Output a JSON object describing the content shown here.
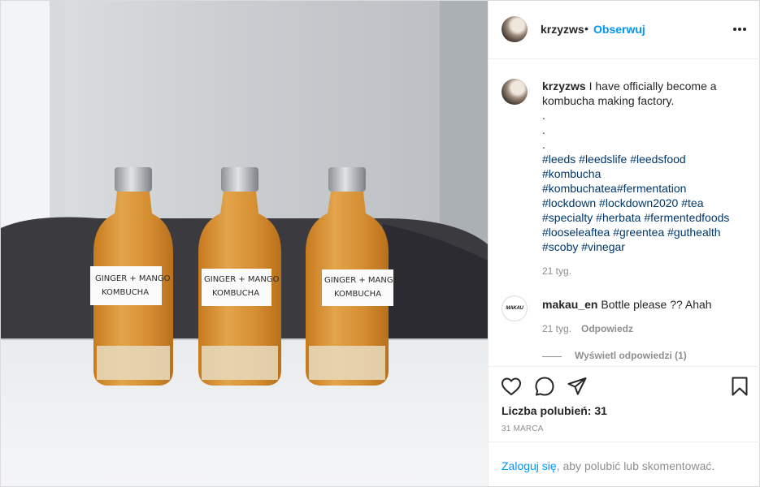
{
  "post": {
    "username": "krzyzws",
    "follow_label": "Obserwuj",
    "dot": "•",
    "photo_label_line1": "GINGER + MANGO",
    "photo_label_line2": "KOMBUCHA"
  },
  "caption": {
    "username": "krzyzws",
    "text": "I have officially become a kombucha making factory.",
    "dots": [
      ".",
      ".",
      "."
    ],
    "hashtags": [
      "#leeds",
      "#leedslife",
      "#leedsfood",
      "#kombucha",
      "#kombuchatea#fermentation",
      "#lockdown",
      "#lockdown2020",
      "#tea",
      "#specialty",
      "#herbata",
      "#fermentedfoods",
      "#looseleaftea",
      "#greentea",
      "#guthealth",
      "#scoby",
      "#vinegar"
    ],
    "time": "21 tyg."
  },
  "comment": {
    "username": "makau_en",
    "avatar_text": "MAKAU",
    "text": "Bottle please ?? Ahah",
    "time": "21 tyg.",
    "reply_label": "Odpowiedz",
    "view_replies": "Wyświetl odpowiedzi (1)"
  },
  "actions": {
    "icons": [
      "heart-icon",
      "comment-icon",
      "share-icon",
      "bookmark-icon"
    ],
    "likes_text": "Liczba polubień: 31",
    "date": "31 MARCA"
  },
  "login": {
    "link": "Zaloguj się",
    "rest": ", aby polubić lub skomentować."
  }
}
